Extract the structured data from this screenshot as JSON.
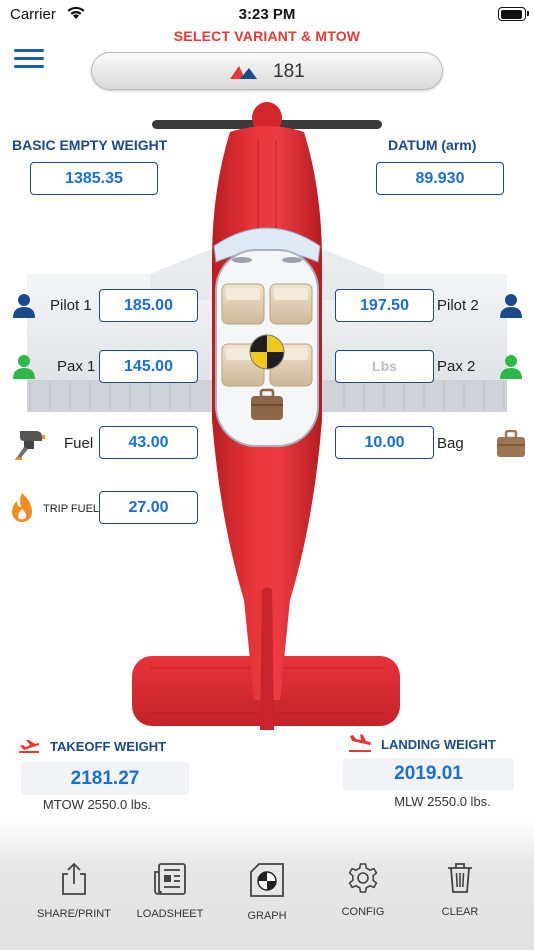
{
  "status_bar": {
    "carrier": "Carrier",
    "time": "3:23 PM"
  },
  "header": {
    "select_title": "SELECT VARIANT & MTOW",
    "variant": "181"
  },
  "basic_empty_weight": {
    "label": "BASIC EMPTY WEIGHT",
    "value": "1385.35"
  },
  "datum": {
    "label": "DATUM (arm)",
    "value": "89.930"
  },
  "pilot1": {
    "label": "Pilot 1",
    "value": "185.00"
  },
  "pilot2": {
    "label": "Pilot 2",
    "value": "197.50"
  },
  "pax1": {
    "label": "Pax 1",
    "value": "145.00"
  },
  "pax2": {
    "label": "Pax 2",
    "placeholder": "Lbs"
  },
  "fuel": {
    "label": "Fuel",
    "value": "43.00"
  },
  "bag": {
    "label": "Bag",
    "value": "10.00"
  },
  "trip_fuel": {
    "label": "TRIP FUEL",
    "value": "27.00"
  },
  "takeoff": {
    "title": "TAKEOFF WEIGHT",
    "value": "2181.27",
    "sub": "MTOW 2550.0 lbs."
  },
  "landing": {
    "title": "LANDING WEIGHT",
    "value": "2019.01",
    "sub": "MLW 2550.0 lbs."
  },
  "toolbar": [
    {
      "label": "SHARE/PRINT",
      "icon": "share-icon"
    },
    {
      "label": "LOADSHEET",
      "icon": "loadsheet-icon"
    },
    {
      "label": "GRAPH",
      "icon": "graph-icon"
    },
    {
      "label": "CONFIG",
      "icon": "gear-icon"
    },
    {
      "label": "CLEAR",
      "icon": "trash-icon"
    }
  ],
  "colors": {
    "accent_red": "#e53935",
    "label_blue": "#1a4a8a",
    "value_blue": "#1a6fd0",
    "pilot_icon": "#1a4a8a",
    "pax_icon": "#2fb84a",
    "fuel_icon": "#f28c1e",
    "plane_red": "#e0262d"
  }
}
